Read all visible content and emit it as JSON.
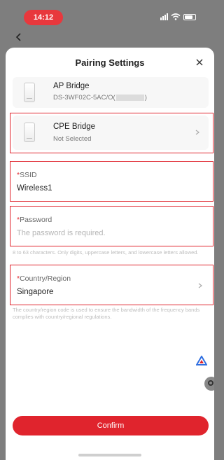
{
  "status_bar": {
    "time": "14:12"
  },
  "sheet": {
    "title": "Pairing Settings"
  },
  "ap_bridge": {
    "title": "AP Bridge",
    "model_prefix": "DS-3WF02C-5AC/O(",
    "model_suffix": ")"
  },
  "cpe_bridge": {
    "title": "CPE Bridge",
    "status": "Not Selected"
  },
  "ssid": {
    "label": "SSID",
    "value": "Wireless1"
  },
  "password": {
    "label": "Password",
    "placeholder": "The password is required.",
    "hint": "8 to 63 characters. Only digits, uppercase letters, and lowercase letters allowed."
  },
  "country": {
    "label": "Country/Region",
    "value": "Singapore",
    "hint": "The country/region code is used to ensure the bandwidth of the frequency bands complies with country/regional regulations."
  },
  "required_marker": "*",
  "confirm_label": "Confirm",
  "colors": {
    "accent": "#e0242d",
    "time_pill": "#e8383d"
  }
}
